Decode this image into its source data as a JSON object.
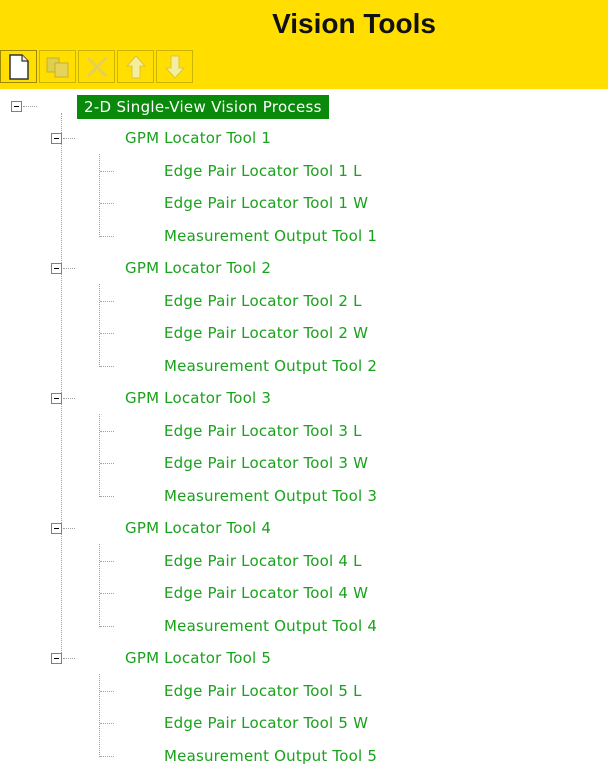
{
  "title": "Vision Tools",
  "toolbar": [
    {
      "name": "new-icon"
    },
    {
      "name": "copy-icon"
    },
    {
      "name": "delete-icon"
    },
    {
      "name": "move-up-icon"
    },
    {
      "name": "move-down-icon"
    }
  ],
  "tree": {
    "root": "2-D Single-View Vision Process",
    "groups": [
      {
        "label": "GPM Locator Tool 1",
        "children": [
          "Edge Pair Locator Tool 1 L",
          "Edge Pair Locator Tool 1 W",
          "Measurement Output Tool 1"
        ]
      },
      {
        "label": "GPM Locator Tool 2",
        "children": [
          "Edge Pair Locator Tool 2 L",
          "Edge Pair Locator Tool 2 W",
          "Measurement Output Tool 2"
        ]
      },
      {
        "label": "GPM Locator Tool 3",
        "children": [
          "Edge Pair Locator Tool 3 L",
          "Edge Pair Locator Tool 3 W",
          "Measurement Output Tool 3"
        ]
      },
      {
        "label": "GPM Locator Tool 4",
        "children": [
          "Edge Pair Locator Tool 4 L",
          "Edge Pair Locator Tool 4 W",
          "Measurement Output Tool 4"
        ]
      },
      {
        "label": "GPM Locator Tool 5",
        "children": [
          "Edge Pair Locator Tool 5 L",
          "Edge Pair Locator Tool 5 W",
          "Measurement Output Tool 5"
        ]
      }
    ]
  }
}
